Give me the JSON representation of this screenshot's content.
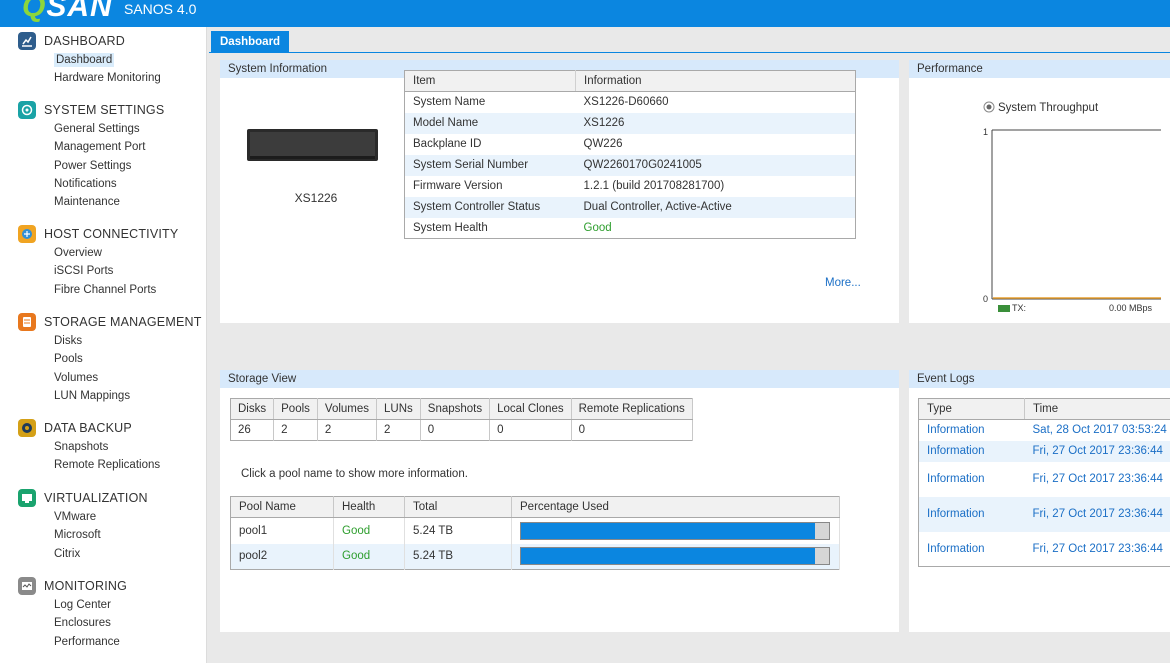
{
  "app": {
    "logo": "SAN",
    "version": "SANOS 4.0"
  },
  "sidebar": {
    "sections": [
      {
        "title": "DASHBOARD",
        "icon": "chart-icon",
        "color": "#2e5d8c",
        "items": [
          "Dashboard",
          "Hardware Monitoring"
        ]
      },
      {
        "title": "SYSTEM SETTINGS",
        "icon": "settings-icon",
        "color": "#1aa3a6",
        "items": [
          "General Settings",
          "Management Port",
          "Power Settings",
          "Notifications",
          "Maintenance"
        ]
      },
      {
        "title": "HOST CONNECTIVITY",
        "icon": "host-icon",
        "color": "#f0a422",
        "items": [
          "Overview",
          "iSCSI Ports",
          "Fibre Channel Ports"
        ]
      },
      {
        "title": "STORAGE MANAGEMENT",
        "icon": "storage-icon",
        "color": "#e8781e",
        "items": [
          "Disks",
          "Pools",
          "Volumes",
          "LUN Mappings"
        ]
      },
      {
        "title": "DATA BACKUP",
        "icon": "backup-icon",
        "color": "#d4a017",
        "items": [
          "Snapshots",
          "Remote Replications"
        ]
      },
      {
        "title": "VIRTUALIZATION",
        "icon": "virtualization-icon",
        "color": "#1aa36e",
        "items": [
          "VMware",
          "Microsoft",
          "Citrix"
        ]
      },
      {
        "title": "MONITORING",
        "icon": "monitoring-icon",
        "color": "#8a8a8a",
        "items": [
          "Log Center",
          "Enclosures",
          "Performance"
        ]
      }
    ]
  },
  "tabs": {
    "active": "Dashboard"
  },
  "system_info": {
    "title": "System Information",
    "device_label": "XS1226",
    "headers": [
      "Item",
      "Information"
    ],
    "rows": [
      [
        "System Name",
        "XS1226-D60660"
      ],
      [
        "Model Name",
        "XS1226"
      ],
      [
        "Backplane ID",
        "QW226"
      ],
      [
        "System Serial Number",
        "QW2260170G0241005"
      ],
      [
        "Firmware Version",
        "1.2.1 (build 201708281700)"
      ],
      [
        "System Controller Status",
        "Dual Controller, Active-Active"
      ],
      [
        "System Health",
        "Good"
      ]
    ],
    "more_link": "More..."
  },
  "performance": {
    "title": "Performance",
    "radio_label": "System Throughput",
    "y_top": "1",
    "y_bottom": "0",
    "legend_label": "TX:",
    "legend_value": "0.00 MBps",
    "legend_color": "#3a8f3a"
  },
  "storage_view": {
    "title": "Storage View",
    "count_headers": [
      "Disks",
      "Pools",
      "Volumes",
      "LUNs",
      "Snapshots",
      "Local Clones",
      "Remote Replications"
    ],
    "count_values": [
      "26",
      "2",
      "2",
      "2",
      "0",
      "0",
      "0"
    ],
    "hint": "Click a pool name to show more information.",
    "pool_headers": [
      "Pool Name",
      "Health",
      "Total",
      "Percentage Used"
    ],
    "pools": [
      {
        "name": "pool1",
        "health": "Good",
        "total": "5.24 TB",
        "used_fraction": 0.955
      },
      {
        "name": "pool2",
        "health": "Good",
        "total": "5.24 TB",
        "used_fraction": 0.955
      }
    ]
  },
  "event_logs": {
    "title": "Event Logs",
    "headers": [
      "Type",
      "Time"
    ],
    "rows": [
      [
        "Information",
        "Sat, 28 Oct 2017 03:53:24"
      ],
      [
        "Information",
        "Fri, 27 Oct 2017 23:36:44"
      ],
      [
        "Information",
        "Fri, 27 Oct 2017 23:36:44"
      ],
      [
        "Information",
        "Fri, 27 Oct 2017 23:36:44"
      ],
      [
        "Information",
        "Fri, 27 Oct 2017 23:36:44"
      ]
    ]
  }
}
